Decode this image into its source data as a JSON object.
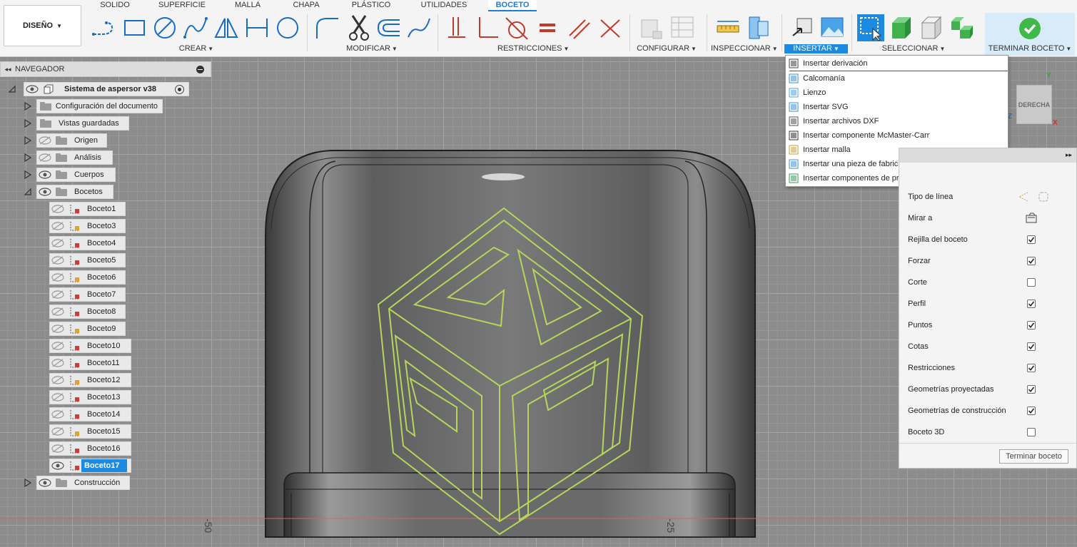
{
  "workspace": {
    "label": "DISEÑO"
  },
  "tabs": [
    {
      "label": "SOLIDO"
    },
    {
      "label": "SUPERFICIE"
    },
    {
      "label": "MALLA"
    },
    {
      "label": "CHAPA"
    },
    {
      "label": "PLÁSTICO"
    },
    {
      "label": "UTILIDADES"
    },
    {
      "label": "BOCETO",
      "active": true
    }
  ],
  "groups": {
    "create": "CREAR",
    "modify": "MODIFICAR",
    "constraints": "RESTRICCIONES",
    "configure": "CONFIGURAR",
    "inspect": "INSPECCIONAR",
    "insert": "INSERTAR",
    "select": "SELECCIONAR",
    "finish": "TERMINAR BOCETO"
  },
  "navigator": {
    "title": "NAVEGADOR",
    "root": "Sistema de aspersor v38",
    "items": {
      "doc_settings": "Configuración del documento",
      "named_views": "Vistas guardadas",
      "origin": "Origen",
      "analysis": "Análisis",
      "bodies": "Cuerpos",
      "sketches": "Bocetos",
      "construction": "Construcción"
    },
    "sketches": [
      "Boceto1",
      "Boceto3",
      "Boceto4",
      "Boceto5",
      "Boceto6",
      "Boceto7",
      "Boceto8",
      "Boceto9",
      "Boceto10",
      "Boceto11",
      "Boceto12",
      "Boceto13",
      "Boceto14",
      "Boceto15",
      "Boceto16",
      "Boceto17"
    ],
    "selected_sketch": "Boceto17"
  },
  "insert_menu": {
    "items": [
      {
        "label": "Insertar derivación",
        "icon": "derive-icon"
      },
      {
        "label": "Calcomanía",
        "icon": "decal-icon"
      },
      {
        "label": "Lienzo",
        "icon": "canvas-icon"
      },
      {
        "label": "Insertar SVG",
        "icon": "svg-icon"
      },
      {
        "label": "Insertar archivos DXF",
        "icon": "dxf-icon"
      },
      {
        "label": "Insertar componente McMaster-Carr",
        "icon": "mcmaster-icon"
      },
      {
        "label": "Insertar malla",
        "icon": "mesh-icon"
      },
      {
        "label": "Insertar una pieza de fabricante",
        "icon": "manufacturer-part-icon"
      },
      {
        "label": "Insertar componentes de proveedor de TraceParts",
        "icon": "traceparts-icon"
      }
    ]
  },
  "viewcube": {
    "label": "DERECHA",
    "axis_y": "Y",
    "axis_x": "X",
    "axis_z": "Z"
  },
  "axis_numbers": {
    "left": "-50",
    "right": "-25"
  },
  "palette": {
    "rows": [
      {
        "label": "Tipo de línea",
        "kind": "icons"
      },
      {
        "label": "Mirar a",
        "kind": "icon"
      },
      {
        "label": "Rejilla del boceto",
        "checked": true
      },
      {
        "label": "Forzar",
        "checked": true
      },
      {
        "label": "Corte",
        "checked": false
      },
      {
        "label": "Perfil",
        "checked": true
      },
      {
        "label": "Puntos",
        "checked": true
      },
      {
        "label": "Cotas",
        "checked": true
      },
      {
        "label": "Restricciones",
        "checked": true
      },
      {
        "label": "Geometrías proyectadas",
        "checked": true
      },
      {
        "label": "Geometrías de construcción",
        "checked": true
      },
      {
        "label": "Boceto 3D",
        "checked": false
      }
    ],
    "finish_button": "Terminar boceto"
  },
  "colors": {
    "accent": "#1b8ae0",
    "sketch_line": "#b5d65a",
    "finish_green": "#41b948"
  }
}
